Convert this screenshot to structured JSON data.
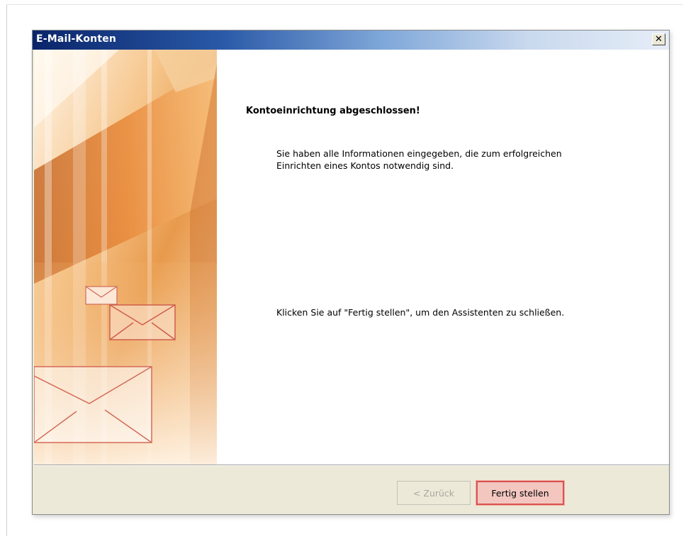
{
  "window": {
    "title": "E-Mail-Konten",
    "close_icon": "close-icon"
  },
  "content": {
    "heading": "Kontoeinrichtung abgeschlossen!",
    "paragraph1": "Sie haben alle Informationen eingegeben, die zum erfolgreichen Einrichten eines Kontos notwendig sind.",
    "paragraph2": "Klicken Sie auf \"Fertig stellen\", um den Assistenten zu schließen."
  },
  "buttons": {
    "back_label": "< Zurück",
    "back_enabled": false,
    "finish_label": "Fertig stellen",
    "finish_highlighted": true
  },
  "colors": {
    "titlebar_dark": "#0a246a",
    "dialog_face": "#ece9d8",
    "highlight": "#d9534f",
    "banner_orange": "#e8893a"
  },
  "banner": {
    "icon": "envelope-graphic"
  }
}
